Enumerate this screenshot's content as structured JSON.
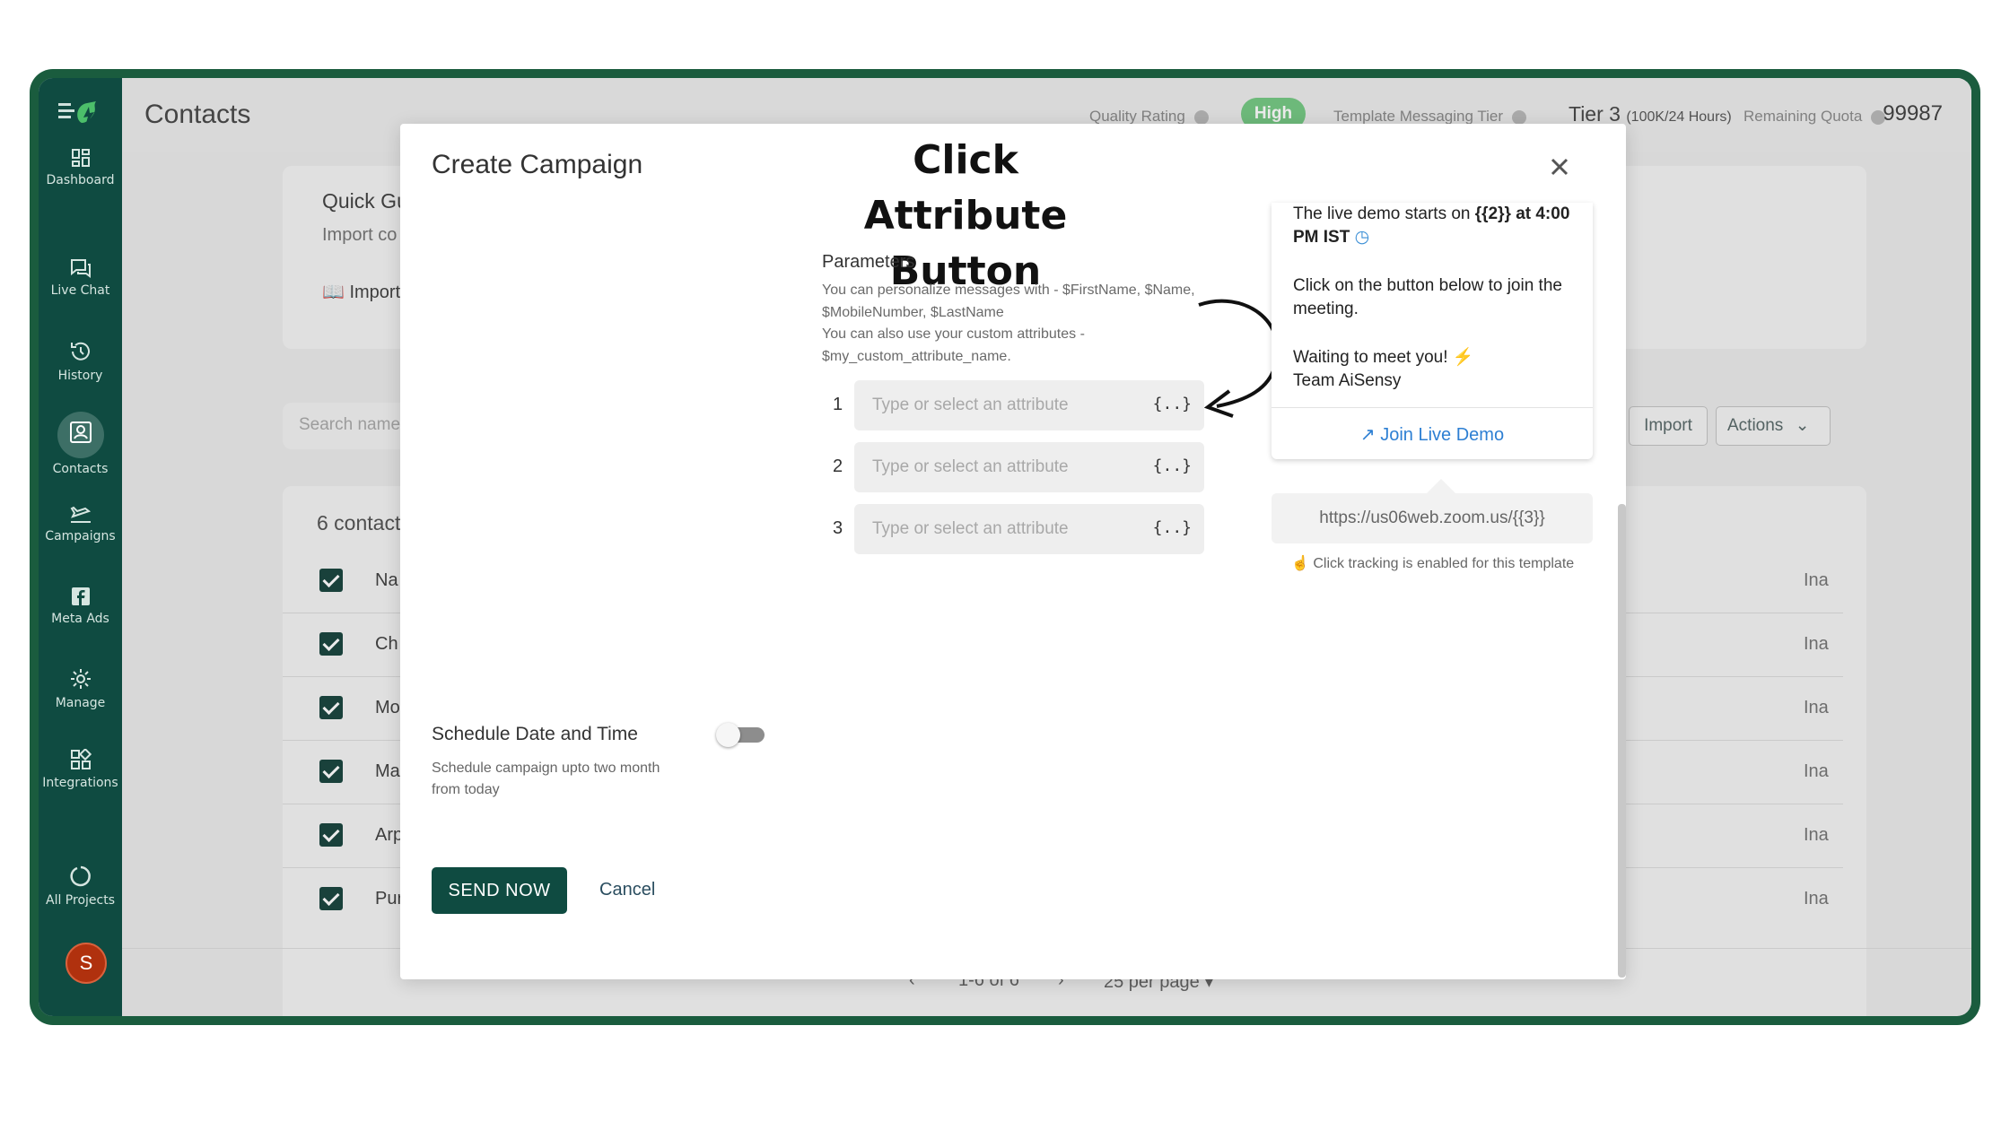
{
  "header": {
    "page_title": "Contacts",
    "quality_rating_label": "Quality Rating",
    "quality_rating_value": "High",
    "tier_label": "Template Messaging Tier",
    "tier_value": "Tier 3",
    "tier_limit": "(100K/24 Hours)",
    "quota_label": "Remaining Quota",
    "quota_value": "99987"
  },
  "sidebar": {
    "items": [
      {
        "label": "Dashboard",
        "icon": "dashboard-icon"
      },
      {
        "label": "Live Chat",
        "icon": "chat-icon"
      },
      {
        "label": "History",
        "icon": "history-icon"
      },
      {
        "label": "Contacts",
        "icon": "contacts-icon"
      },
      {
        "label": "Campaigns",
        "icon": "plane-icon"
      },
      {
        "label": "Meta Ads",
        "icon": "facebook-icon"
      },
      {
        "label": "Manage",
        "icon": "gear-icon"
      },
      {
        "label": "Integrations",
        "icon": "integrations-icon"
      },
      {
        "label": "All Projects",
        "icon": "projects-icon"
      }
    ],
    "avatar_initial": "S"
  },
  "background": {
    "quick_guide_title": "Quick Gu",
    "quick_guide_sub": "Import co",
    "import_link": "Import",
    "search_placeholder": "Search name",
    "contacts_count": "6 contact",
    "import_button": "Import",
    "actions_button": "Actions",
    "rows": [
      {
        "name": "Na",
        "status": "Ina"
      },
      {
        "name": "Ch",
        "status": "Ina"
      },
      {
        "name": "Mo",
        "status": "Ina"
      },
      {
        "name": "Ma",
        "status": "Ina"
      },
      {
        "name": "Arp",
        "status": "Ina"
      },
      {
        "name": "Pur",
        "status": "Ina"
      }
    ],
    "pager_range": "1-6 of 6",
    "per_page": "25 per page"
  },
  "modal": {
    "title": "Create Campaign",
    "callout": "Click Attribute Button",
    "params_title": "Parameters",
    "params_desc_1": "You can personalize messages with - $FirstName, $Name, $MobileNumber, $LastName",
    "params_desc_2": "You can also use your custom attributes - $my_custom_attribute_name.",
    "params": [
      {
        "index": "1",
        "placeholder": "Type or select an attribute",
        "button": "{..}"
      },
      {
        "index": "2",
        "placeholder": "Type or select an attribute",
        "button": "{..}"
      },
      {
        "index": "3",
        "placeholder": "Type or select an attribute",
        "button": "{..}"
      }
    ],
    "preview": {
      "line1_prefix": "The live demo starts on ",
      "line1_bold": "{{2}} at 4:00 PM IST",
      "line2": "Click on the button below to join the meeting.",
      "line3": "Waiting to meet you!",
      "line4": "Team AiSensy",
      "button": "Join Live Demo",
      "url": "https://us06web.zoom.us/{{3}}",
      "tracking": "Click tracking is enabled for this template"
    },
    "schedule_title": "Schedule Date and Time",
    "schedule_desc": "Schedule campaign upto two month from today",
    "schedule_enabled": false,
    "send_button": "SEND NOW",
    "cancel_button": "Cancel"
  },
  "colors": {
    "frame": "#1a5c3e",
    "sidebar": "#0f4b41",
    "primary_button": "#0f4b41",
    "link": "#2d7fd3",
    "high_badge": "#77c985"
  }
}
